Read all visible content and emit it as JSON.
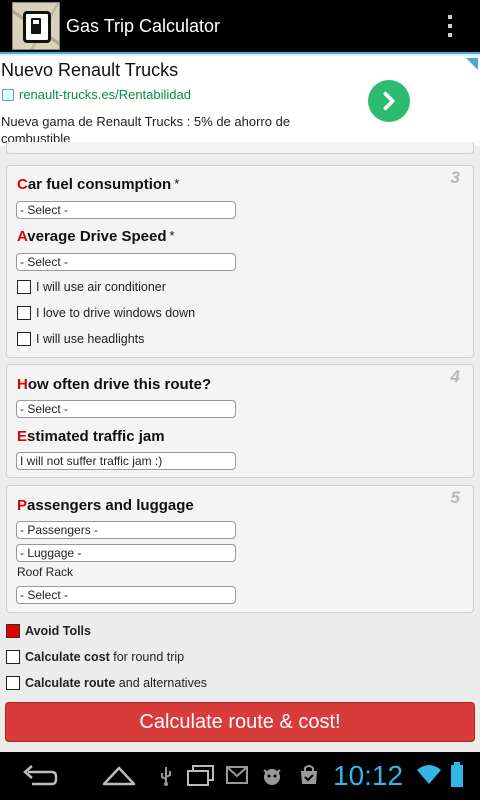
{
  "app": {
    "title": "Gas Trip Calculator"
  },
  "ad": {
    "title": "Nuevo Renault Trucks",
    "url": "renault-trucks.es/Rentabilidad",
    "description": "Nueva gama de Renault Trucks : 5% de ahorro de combustible"
  },
  "section3": {
    "number": "3",
    "fuel_label_first": "C",
    "fuel_label_rest": "ar fuel consumption",
    "fuel_required": "*",
    "fuel_select": "- Select -",
    "speed_label_first": "A",
    "speed_label_rest": "verage Drive Speed",
    "speed_required": "*",
    "speed_select": "- Select -",
    "checks": [
      {
        "label": "I will use air conditioner",
        "checked": false
      },
      {
        "label": "I love to drive windows down",
        "checked": false
      },
      {
        "label": "I will use headlights",
        "checked": false
      }
    ]
  },
  "section4": {
    "number": "4",
    "often_label_first": "H",
    "often_label_rest": "ow often drive this route?",
    "often_select": "- Select -",
    "traffic_label_first": "E",
    "traffic_label_rest": "stimated traffic jam",
    "traffic_select": "I will not suffer traffic jam :)"
  },
  "section5": {
    "number": "5",
    "passengers_label_first": "P",
    "passengers_label_rest": "assengers and luggage",
    "passengers_select": "- Passengers -",
    "luggage_select": "- Luggage -",
    "roof_rack_label": "Roof Rack",
    "roof_rack_select": "- Select -"
  },
  "options": {
    "avoid_tolls": {
      "label": "Avoid Tolls",
      "checked": true
    },
    "round_trip": {
      "bold": "Calculate cost",
      "rest": " for round trip",
      "checked": false
    },
    "alternatives": {
      "bold": "Calculate route",
      "rest": " and alternatives",
      "checked": false
    }
  },
  "calculate_button": "Calculate route & cost!",
  "status": {
    "time": "10:12"
  },
  "colors": {
    "accent": "#33b5e5",
    "required_red": "#e00000",
    "button_red": "#d93b3b",
    "ad_green": "#2dbb70"
  }
}
